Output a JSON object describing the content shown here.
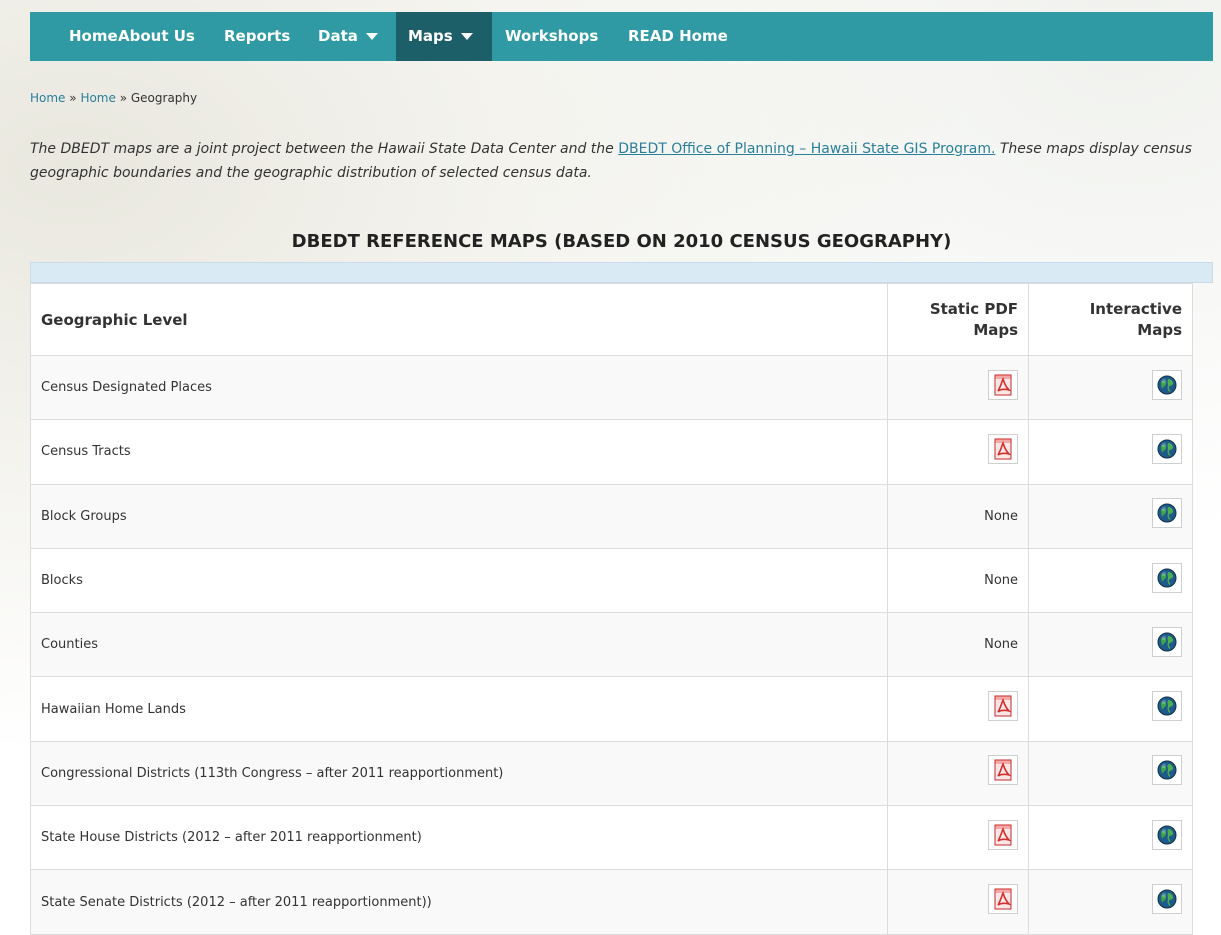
{
  "nav": {
    "items": [
      {
        "label": "Home"
      },
      {
        "label": "About Us"
      },
      {
        "label": "Reports"
      },
      {
        "label": "Data"
      },
      {
        "label": "Maps"
      },
      {
        "label": "Workshops"
      },
      {
        "label": "READ Home"
      }
    ],
    "active_item": "Maps"
  },
  "breadcrumb": {
    "items": [
      "Home",
      "Home",
      "Geography"
    ],
    "separator": "»"
  },
  "intro": {
    "text_before": "The DBEDT maps are a joint project between the Hawaii State Data Center and the ",
    "link_text": "DBEDT Office of Planning – Hawaii State GIS Program.",
    "text_after": " These maps display census geographic boundaries and the geographic distribution of selected census data."
  },
  "title": "DBEDT REFERENCE MAPS (BASED ON 2010 CENSUS GEOGRAPHY)",
  "table": {
    "headers": {
      "level": "Geographic Level",
      "pdf_line1": "Static PDF",
      "pdf_line2": "Maps",
      "inter_line1": "Interactive",
      "inter_line2": "Maps"
    },
    "none_label": "None",
    "rows": [
      {
        "level": "Census Designated Places",
        "pdf": true,
        "interactive": true
      },
      {
        "level": "Census Tracts",
        "pdf": true,
        "interactive": true
      },
      {
        "level": "Block Groups",
        "pdf": false,
        "interactive": true
      },
      {
        "level": "Blocks",
        "pdf": false,
        "interactive": true
      },
      {
        "level": "Counties",
        "pdf": false,
        "interactive": true
      },
      {
        "level": "Hawaiian Home Lands",
        "pdf": true,
        "interactive": true
      },
      {
        "level": "Congressional Districts (113th Congress – after 2011 reapportionment)",
        "pdf": true,
        "interactive": true
      },
      {
        "level": "State House Districts (2012 – after 2011 reapportionment)",
        "pdf": true,
        "interactive": true
      },
      {
        "level": "State Senate Districts (2012 – after 2011 reapportionment))",
        "pdf": true,
        "interactive": true
      }
    ]
  },
  "icons": {
    "pdf": "pdf-file-icon",
    "interactive": "globe-map-icon",
    "dropdown": "caret-down-icon"
  },
  "colors": {
    "nav_bg": "#2f9aa3",
    "nav_active_bg": "#1d5f68",
    "link": "#2a7f9a",
    "table_top_bar": "#d9eaf5"
  }
}
